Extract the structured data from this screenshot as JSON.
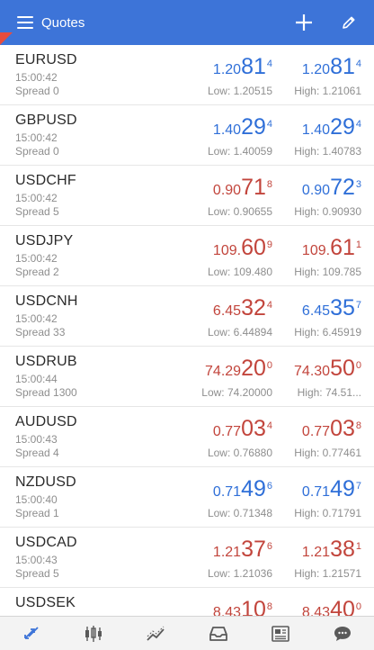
{
  "header": {
    "title": "Quotes",
    "add_icon": "plus-icon",
    "edit_icon": "pencil-icon"
  },
  "colors": {
    "accent": "#3d74d8",
    "up": "#2f6fd8",
    "down": "#c2453c",
    "corner": "#e84c3d"
  },
  "quotes": [
    {
      "symbol": "EURUSD",
      "time": "15:00:42",
      "spread": "Spread 0",
      "bid": {
        "pre": "1.20",
        "big": "81",
        "sup": "4",
        "dir": "up"
      },
      "ask": {
        "pre": "1.20",
        "big": "81",
        "sup": "4",
        "dir": "up"
      },
      "low": "Low: 1.20515",
      "high": "High: 1.21061"
    },
    {
      "symbol": "GBPUSD",
      "time": "15:00:42",
      "spread": "Spread 0",
      "bid": {
        "pre": "1.40",
        "big": "29",
        "sup": "4",
        "dir": "up"
      },
      "ask": {
        "pre": "1.40",
        "big": "29",
        "sup": "4",
        "dir": "up"
      },
      "low": "Low: 1.40059",
      "high": "High: 1.40783"
    },
    {
      "symbol": "USDCHF",
      "time": "15:00:42",
      "spread": "Spread 5",
      "bid": {
        "pre": "0.90",
        "big": "71",
        "sup": "8",
        "dir": "down"
      },
      "ask": {
        "pre": "0.90",
        "big": "72",
        "sup": "3",
        "dir": "up"
      },
      "low": "Low: 0.90655",
      "high": "High: 0.90930"
    },
    {
      "symbol": "USDJPY",
      "time": "15:00:42",
      "spread": "Spread 2",
      "bid": {
        "pre": "109.",
        "big": "60",
        "sup": "9",
        "dir": "down"
      },
      "ask": {
        "pre": "109.",
        "big": "61",
        "sup": "1",
        "dir": "down"
      },
      "low": "Low: 109.480",
      "high": "High: 109.785"
    },
    {
      "symbol": "USDCNH",
      "time": "15:00:42",
      "spread": "Spread 33",
      "bid": {
        "pre": "6.45",
        "big": "32",
        "sup": "4",
        "dir": "down"
      },
      "ask": {
        "pre": "6.45",
        "big": "35",
        "sup": "7",
        "dir": "up"
      },
      "low": "Low: 6.44894",
      "high": "High: 6.45919"
    },
    {
      "symbol": "USDRUB",
      "time": "15:00:44",
      "spread": "Spread 1300",
      "bid": {
        "pre": "74.29",
        "big": "20",
        "sup": "0",
        "dir": "down"
      },
      "ask": {
        "pre": "74.30",
        "big": "50",
        "sup": "0",
        "dir": "down"
      },
      "low": "Low: 74.20000",
      "high": "High: 74.51..."
    },
    {
      "symbol": "AUDUSD",
      "time": "15:00:43",
      "spread": "Spread 4",
      "bid": {
        "pre": "0.77",
        "big": "03",
        "sup": "4",
        "dir": "down"
      },
      "ask": {
        "pre": "0.77",
        "big": "03",
        "sup": "8",
        "dir": "down"
      },
      "low": "Low: 0.76880",
      "high": "High: 0.77461"
    },
    {
      "symbol": "NZDUSD",
      "time": "15:00:40",
      "spread": "Spread 1",
      "bid": {
        "pre": "0.71",
        "big": "49",
        "sup": "6",
        "dir": "up"
      },
      "ask": {
        "pre": "0.71",
        "big": "49",
        "sup": "7",
        "dir": "up"
      },
      "low": "Low: 0.71348",
      "high": "High: 0.71791"
    },
    {
      "symbol": "USDCAD",
      "time": "15:00:43",
      "spread": "Spread 5",
      "bid": {
        "pre": "1.21",
        "big": "37",
        "sup": "6",
        "dir": "down"
      },
      "ask": {
        "pre": "1.21",
        "big": "38",
        "sup": "1",
        "dir": "down"
      },
      "low": "Low: 1.21036",
      "high": "High: 1.21571"
    },
    {
      "symbol": "USDSEK",
      "time": "",
      "spread": "",
      "bid": {
        "pre": "8.43",
        "big": "10",
        "sup": "8",
        "dir": "down"
      },
      "ask": {
        "pre": "8.43",
        "big": "40",
        "sup": "0",
        "dir": "down"
      },
      "low": "",
      "high": ""
    }
  ],
  "nav": [
    {
      "name": "quotes-tab",
      "icon": "exchange-arrows-icon",
      "active": true
    },
    {
      "name": "chart-tab",
      "icon": "candlestick-icon",
      "active": false
    },
    {
      "name": "trade-tab",
      "icon": "trend-line-icon",
      "active": false
    },
    {
      "name": "history-tab",
      "icon": "inbox-tray-icon",
      "active": false
    },
    {
      "name": "news-tab",
      "icon": "newspaper-icon",
      "active": false
    },
    {
      "name": "chat-tab",
      "icon": "chat-bubble-icon",
      "active": false
    }
  ]
}
